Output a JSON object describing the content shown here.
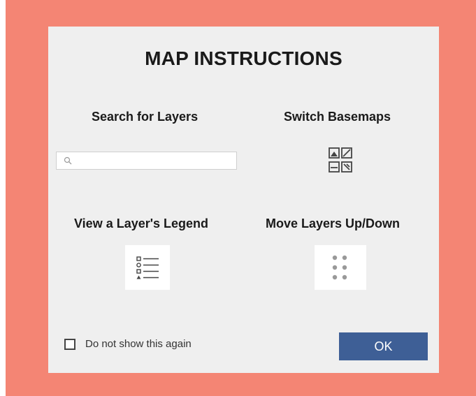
{
  "dialog": {
    "title": "MAP INSTRUCTIONS",
    "sections": {
      "search": {
        "label": "Search for Layers",
        "placeholder": ""
      },
      "basemaps": {
        "label": "Switch Basemaps",
        "icon": "basemap-gallery-icon"
      },
      "legend": {
        "label": "View a Layer's Legend",
        "icon": "legend-list-icon"
      },
      "move": {
        "label": "Move Layers Up/Down",
        "icon": "drag-handle-icon"
      }
    },
    "footer": {
      "checkbox_label": "Do not show this again",
      "checkbox_checked": false,
      "ok_label": "OK"
    }
  },
  "colors": {
    "backdrop": "#f48574",
    "dialog_bg": "#efefef",
    "ok_button": "#3e5f96"
  }
}
